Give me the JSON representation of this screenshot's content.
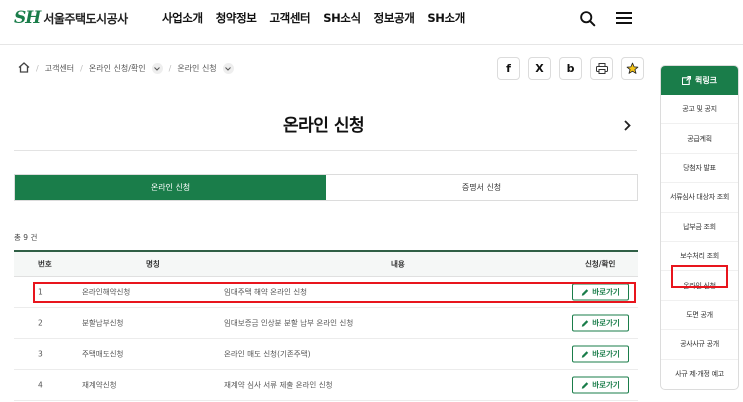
{
  "header": {
    "logo_mark": "SH",
    "logo_text": "서울주택도시공사",
    "nav": [
      "사업소개",
      "청약정보",
      "고객센터",
      "SH소식",
      "정보공개",
      "SH소개"
    ]
  },
  "breadcrumb": {
    "items": [
      "고객센터",
      "온라인 신청/확인",
      "온라인 신청"
    ]
  },
  "share": {
    "facebook": "f",
    "x": "X",
    "blog": "b"
  },
  "page": {
    "title": "온라인 신청"
  },
  "tabs": [
    {
      "label": "온라인 신청",
      "active": true
    },
    {
      "label": "증명서 신청",
      "active": false
    }
  ],
  "total": {
    "label": "총",
    "count": "9",
    "unit": "건"
  },
  "table": {
    "headers": {
      "no": "번호",
      "name": "명칭",
      "desc": "내용",
      "action": "신청/확인"
    },
    "rows": [
      {
        "no": "1",
        "name": "온라인해약신청",
        "desc": "임대주택 해약 온라인 신청",
        "btn": "바로가기"
      },
      {
        "no": "2",
        "name": "분할납부신청",
        "desc": "임대보증금 인상분 분할 납부 온라인 신청",
        "btn": "바로가기"
      },
      {
        "no": "3",
        "name": "주택매도신청",
        "desc": "온라인 매도 신청(기존주택)",
        "btn": "바로가기"
      },
      {
        "no": "4",
        "name": "재계약신청",
        "desc": "재계약 심사 서류 제출 온라인 신청",
        "btn": "바로가기"
      }
    ]
  },
  "quick": {
    "title": "퀵링크",
    "items": [
      "공고 및 공지",
      "공급계획",
      "당첨자 발표",
      "서류심사 대상자 조회",
      "납부금 조회",
      "보수처리 조회",
      "온라인 신청",
      "도면 공개",
      "공사사규 공개",
      "사규 제·개정 예고"
    ]
  },
  "colors": {
    "brand_green": "#1a7d4a",
    "highlight_red": "#e8151d"
  }
}
